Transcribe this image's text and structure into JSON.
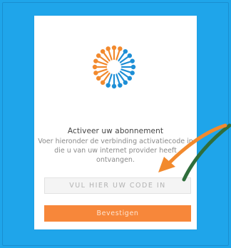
{
  "colors": {
    "background": "#1fa5ea",
    "card": "#ffffff",
    "accent": "#f7873a",
    "annotation_arrow_green": "#2f6e3c",
    "annotation_arrow_orange": "#f28a2e"
  },
  "logo": {
    "icon": "sunburst-logo-icon"
  },
  "activation": {
    "heading": "Activeer uw abonnement",
    "instructions": "Voer hieronder de verbinding activatiecode in die u van uw internet provider heeft ontvangen.",
    "code_placeholder": "VUL HIER UW CODE IN",
    "code_value": "",
    "confirm_label": "Bevestigen"
  },
  "annotation": {
    "icon": "pointer-arrow-icon"
  }
}
